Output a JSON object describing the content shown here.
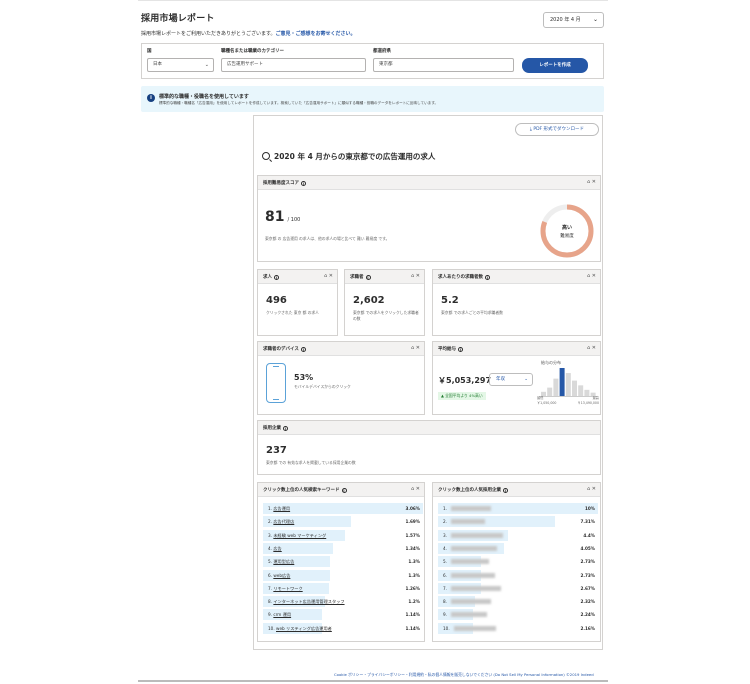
{
  "header": {
    "title": "採用市場レポート",
    "intro": "採用市場レポートをご利用いただきありがとうございます。",
    "feedback_link": "ご意見・ご感想をお寄せください。",
    "period": "2020 年 4 月"
  },
  "filters": {
    "country_label": "国",
    "country_value": "日本",
    "keyword_label": "職種名または職業のカテゴリー",
    "keyword_value": "広告運用サポート",
    "location_label": "都道府県",
    "location_value": "東京都",
    "run_button": "レポートを作成"
  },
  "notice": {
    "title": "標準的な職種・役職名を使用しています",
    "body": "標準的な職種・職種名「広告運用」を使用してレポートを作成しています。検索していた「広告運用サポート」に類似する職種・役職のデータをレポートに反映しています。"
  },
  "report": {
    "pdf_button": "PDF 形式でダウンロード",
    "title": "2020 年 4 月からの東京都での広告運用の求人",
    "score": {
      "title": "採用難易度スコア",
      "value": "81",
      "max": "/ 100",
      "desc": "東京都 の 広告運用 の求人は、他の求人の場と比べて 難い 難易度 です。",
      "gauge_label_1": "高い",
      "gauge_label_2": "難易度",
      "gauge_fraction": 0.81
    },
    "jobs": {
      "title": "求人",
      "value": "496",
      "desc": "クリックされた 東京 都 の求人"
    },
    "seekers": {
      "title": "求職者",
      "value": "2,602",
      "desc": "東京都 での求人をクリックした求職者の数"
    },
    "per_job": {
      "title": "求人あたりの求職者数",
      "value": "5.2",
      "desc": "東京都 での求人ごとの平均求職者数"
    },
    "device": {
      "title": "求職者のデバイス",
      "value": "53%",
      "desc": "モバイルデバイスからのクリック"
    },
    "salary": {
      "title": "平均給与",
      "value": "￥5,053,297",
      "unit": "年収",
      "note": "▲ 全国平均より 4%高い",
      "dist_title": "給与の分布",
      "min_label": "最低",
      "min_value": "￥1,050,000",
      "max_label": "最高",
      "max_value": "￥13,490,000",
      "bars": [
        0.15,
        0.3,
        0.62,
        1.0,
        0.82,
        0.55,
        0.38,
        0.22,
        0.12
      ],
      "highlight_index": 3
    },
    "companies": {
      "title": "採用企業",
      "value": "237",
      "desc": "東京都 での 有効な求人を掲載している採用企業の数"
    },
    "keywords": {
      "title": "クリック数上位の人気検索キーワード",
      "rows": [
        {
          "n": "1.",
          "label": "広告運用",
          "value": "3.06%",
          "fraction": 1.0
        },
        {
          "n": "2.",
          "label": "広告代理店",
          "value": "1.69%",
          "fraction": 0.55
        },
        {
          "n": "3.",
          "label": "未経験 web マーケティング",
          "value": "1.57%",
          "fraction": 0.51
        },
        {
          "n": "4.",
          "label": "広告",
          "value": "1.34%",
          "fraction": 0.44
        },
        {
          "n": "5.",
          "label": "運用型広告",
          "value": "1.3%",
          "fraction": 0.42
        },
        {
          "n": "6.",
          "label": "web広告",
          "value": "1.3%",
          "fraction": 0.42
        },
        {
          "n": "7.",
          "label": "リモートワーク",
          "value": "1.26%",
          "fraction": 0.41
        },
        {
          "n": "8.",
          "label": "インターネット広告運用管理スタッフ",
          "value": "1.2%",
          "fraction": 0.39
        },
        {
          "n": "9.",
          "label": "crm 運用",
          "value": "1.14%",
          "fraction": 0.37
        },
        {
          "n": "10.",
          "label": "web リスティング広告運用者",
          "value": "1.14%",
          "fraction": 0.37
        }
      ]
    },
    "top_companies": {
      "title": "クリック数上位の人気採用企業",
      "rows": [
        {
          "n": "1.",
          "value": "10%",
          "fraction": 1.0
        },
        {
          "n": "2.",
          "value": "7.31%",
          "fraction": 0.73
        },
        {
          "n": "3.",
          "value": "4.4%",
          "fraction": 0.44
        },
        {
          "n": "4.",
          "value": "4.05%",
          "fraction": 0.41
        },
        {
          "n": "5.",
          "value": "2.73%",
          "fraction": 0.27
        },
        {
          "n": "6.",
          "value": "2.73%",
          "fraction": 0.27
        },
        {
          "n": "7.",
          "value": "2.67%",
          "fraction": 0.27
        },
        {
          "n": "8.",
          "value": "2.32%",
          "fraction": 0.23
        },
        {
          "n": "9.",
          "value": "2.24%",
          "fraction": 0.22
        },
        {
          "n": "10.",
          "value": "2.16%",
          "fraction": 0.22
        }
      ]
    }
  },
  "footer": "Cookie ポリシー・プライバシーポリシー・利用規約・私の個人情報を販売しないでください (Do Not Sell My Personal Information) ©2019 Indeed",
  "colors": {
    "accent": "#2557a7",
    "gauge": "#e7a48a",
    "row_bar": "#e1f1fb",
    "notice_bg": "#e8f6fc"
  }
}
